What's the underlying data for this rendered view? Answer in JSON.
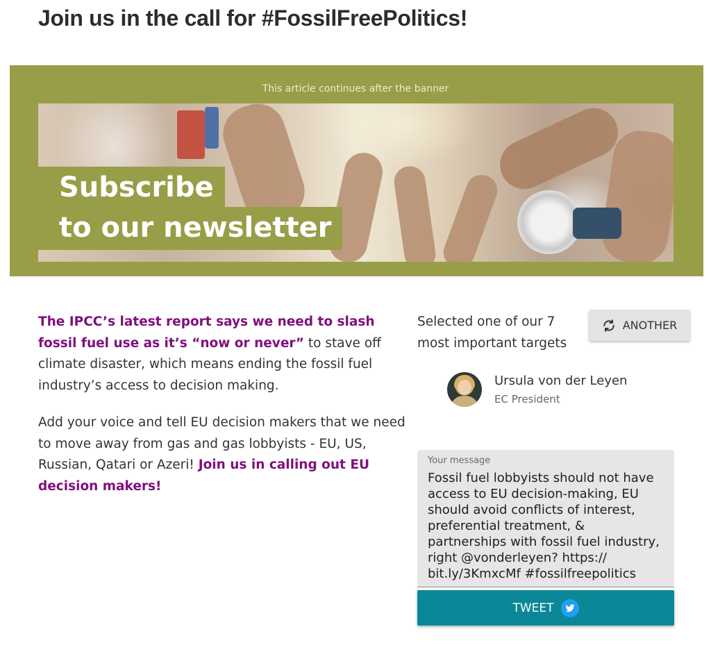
{
  "page": {
    "title": "Join us in the call for #FossilFreePolitics!"
  },
  "banner": {
    "note": "This article continues after the banner",
    "headline_line1": "Subscribe",
    "headline_line2": "to our newsletter",
    "background_color": "#989e48"
  },
  "article": {
    "para1_highlight": "The IPCC’s latest report says we need to slash fossil fuel use as it’s “now or never”",
    "para1_rest": " to stave off climate disaster, which means ending the fossil fuel industry’s access to decision making.",
    "para2_text": "Add your voice and tell EU decision makers that we need to move away from gas and gas lobbyists - EU, US, Russian, Qatari or Azeri! ",
    "para2_highlight": "Join us in calling out EU decision makers!",
    "highlight_color": "#800f7f"
  },
  "target": {
    "selection_label": "Selected one of our 7 most important targets",
    "another_button": "ANOTHER",
    "another_icon": "refresh-icon",
    "name": "Ursula von der Leyen",
    "role": "EC President"
  },
  "message": {
    "label": "Your message",
    "value": "Fossil fuel lobbyists should not have access to EU decision-making, EU should avoid conflicts of interest, preferential treatment, & partnerships with fossil fuel industry, right @vonderleyen? https://\nbit.ly/3KmxcMf #fossilfreepolitics"
  },
  "tweet": {
    "button_label": "TWEET",
    "icon": "twitter-icon",
    "button_color": "#0b8897"
  }
}
